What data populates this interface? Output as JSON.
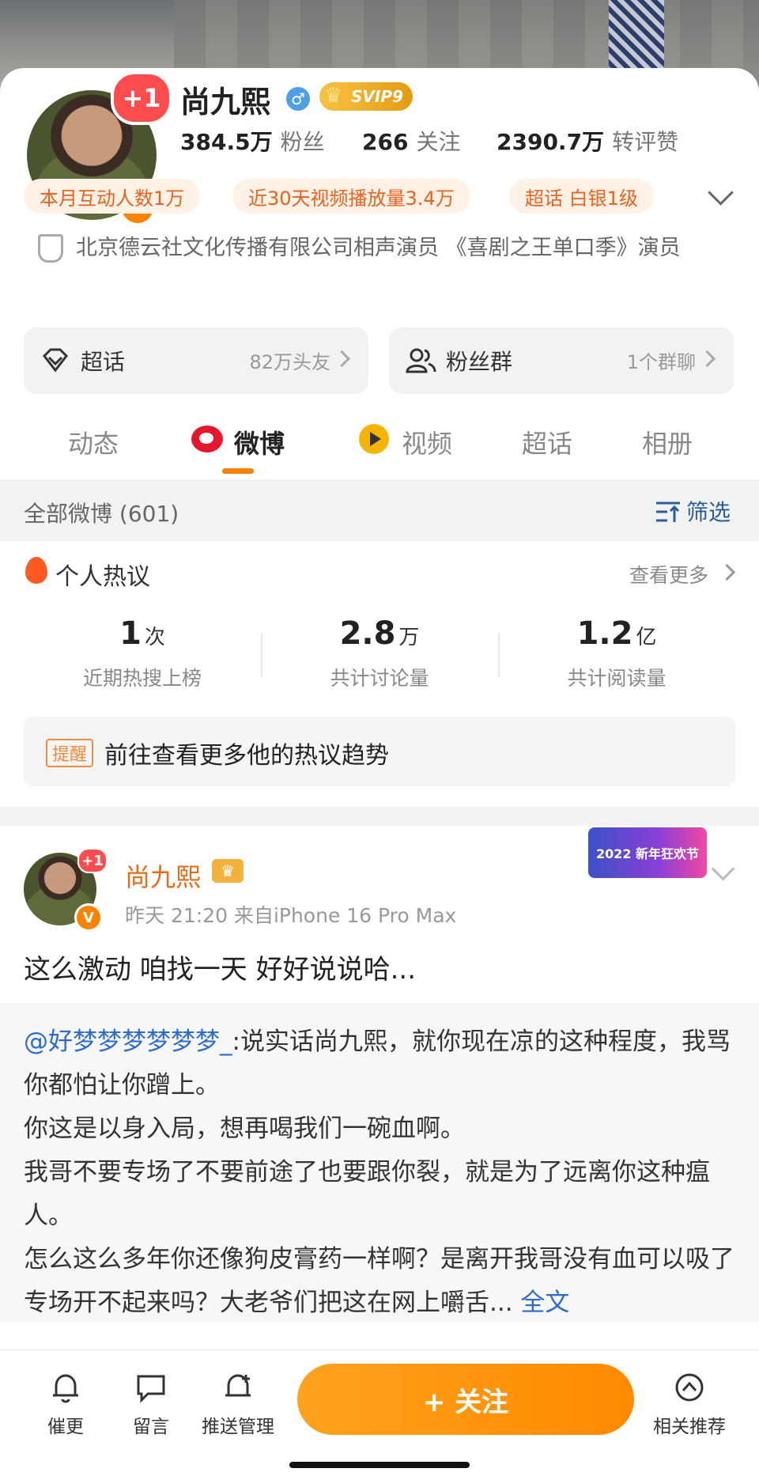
{
  "profile": {
    "name": "尚九熙",
    "avatar_badge": "+1",
    "verified_badge": "V",
    "gender_symbol": "♂",
    "vip_label": "SVIP9",
    "stats": [
      {
        "value": "384.5万",
        "label": "粉丝"
      },
      {
        "value": "266",
        "label": "关注"
      },
      {
        "value": "2390.7万",
        "label": "转评赞"
      }
    ],
    "tags": [
      "本月互动人数1万",
      "近30天视频播放量3.4万",
      "超话 白银1级"
    ],
    "bio": "北京德云社文化传播有限公司相声演员 《喜剧之王单口季》演员"
  },
  "entries": [
    {
      "title": "超话",
      "count": "82万头友",
      "icon": "diamond-icon"
    },
    {
      "title": "粉丝群",
      "count": "1个群聊",
      "icon": "group-icon"
    }
  ],
  "tabs": [
    "动态",
    "微博",
    "视频",
    "超话",
    "相册"
  ],
  "active_tab": "微博",
  "feed_header": {
    "all_weibo": "全部微博 (601)",
    "filter": "筛选"
  },
  "hot": {
    "title": "个人热议",
    "more": "查看更多",
    "metrics": [
      {
        "num": "1",
        "unit": "次",
        "label": "近期热搜上榜"
      },
      {
        "num": "2.8",
        "unit": "万",
        "label": "共计讨论量"
      },
      {
        "num": "1.2",
        "unit": "亿",
        "label": "共计阅读量"
      }
    ],
    "reminder_tag": "提醒",
    "reminder_text": "前往查看更多他的热议趋势"
  },
  "post": {
    "author": "尚九熙",
    "avatar_badge": "+1",
    "verified_badge": "V",
    "crown_symbol": "♛",
    "meta": "昨天 21:20  来自iPhone 16 Pro Max",
    "decoration": "2022 新年狂欢节",
    "text": "这么激动 咱找一天 好好说说哈...",
    "quote_mention": "@好梦梦梦梦梦梦_",
    "quote_body": ":说实话尚九熙，就你现在凉的这种程度，我骂你都怕让你蹭上。\n你这是以身入局，想再喝我们一碗血啊。\n我哥不要专场了不要前途了也要跟你裂，就是为了远离你这种瘟人。\n怎么这么多年你还像狗皮膏药一样啊？是离开我哥没有血可以吸了专场开不起来吗？大老爷们把这在网上嚼舌...",
    "quote_more": " 全文"
  },
  "bottom_bar": {
    "items": [
      {
        "label": "催更",
        "icon": "bell-icon"
      },
      {
        "label": "留言",
        "icon": "message-icon"
      },
      {
        "label": "推送管理",
        "icon": "bell-plus-icon"
      },
      {
        "label": "相关推荐",
        "icon": "chevron-up-circle-icon"
      }
    ],
    "follow": "+ 关注"
  },
  "colors": {
    "accent": "#ff8200",
    "link": "#2b6bd1",
    "tag_text": "#e8631e",
    "tag_bg": "#fff1e6"
  }
}
